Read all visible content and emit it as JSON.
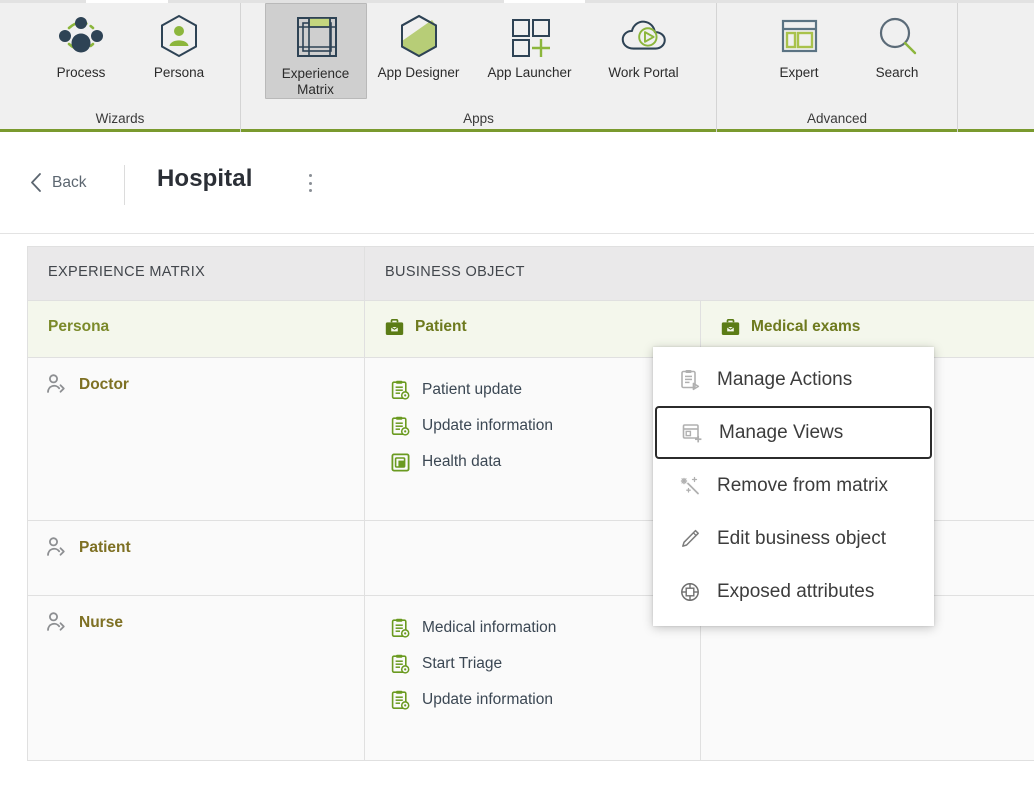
{
  "ribbon": {
    "groups": [
      {
        "label": "Wizards",
        "items": [
          {
            "label": "Process",
            "icon": "process-network-icon",
            "selected": false
          },
          {
            "label": "Persona",
            "icon": "persona-hexagon-user-icon",
            "selected": false
          }
        ]
      },
      {
        "label": "Apps",
        "items": [
          {
            "label": "Experience\nMatrix",
            "label_line1": "Experience",
            "label_line2": "Matrix",
            "icon": "experience-matrix-icon",
            "selected": true
          },
          {
            "label": "App Designer",
            "icon": "app-designer-hexagon-icon",
            "selected": false
          },
          {
            "label": "App Launcher",
            "icon": "app-launcher-grid-plus-icon",
            "selected": false
          },
          {
            "label": "Work Portal",
            "icon": "work-portal-cloud-play-icon",
            "selected": false
          }
        ]
      },
      {
        "label": "Advanced",
        "items": [
          {
            "label": "Expert",
            "icon": "expert-window-panels-icon",
            "selected": false
          },
          {
            "label": "Search",
            "icon": "search-magnifier-icon",
            "selected": false
          }
        ]
      }
    ]
  },
  "titlebar": {
    "back_label": "Back",
    "title": "Hospital",
    "more_icon": "kebab-menu-icon"
  },
  "matrix": {
    "band": {
      "col0": "EXPERIENCE MATRIX",
      "col1": "BUSINESS OBJECT",
      "col2": ""
    },
    "headers": {
      "persona": "Persona",
      "objects": [
        {
          "label": "Patient",
          "icon": "briefcase-icon"
        },
        {
          "label": "Medical exams",
          "icon": "briefcase-icon"
        }
      ]
    },
    "rows": [
      {
        "persona": "Doctor",
        "persona_icon": "persona-arrow-icon",
        "cells": [
          [
            {
              "label": "Patient update",
              "icon": "clipboard-gear-icon"
            },
            {
              "label": "Update information",
              "icon": "clipboard-gear-icon"
            },
            {
              "label": "Health data",
              "icon": "view-window-icon"
            }
          ],
          []
        ]
      },
      {
        "persona": "Patient",
        "persona_icon": "persona-arrow-icon",
        "cells": [
          [],
          []
        ]
      },
      {
        "persona": "Nurse",
        "persona_icon": "persona-arrow-icon",
        "cells": [
          [
            {
              "label": "Medical information",
              "icon": "clipboard-gear-icon"
            },
            {
              "label": "Start Triage",
              "icon": "clipboard-gear-icon"
            },
            {
              "label": "Update information",
              "icon": "clipboard-gear-icon"
            }
          ],
          []
        ]
      }
    ]
  },
  "context_menu": {
    "items": [
      {
        "label": "Manage Actions",
        "icon": "manage-actions-icon",
        "focused": false
      },
      {
        "label": "Manage Views",
        "icon": "manage-views-icon",
        "focused": true
      },
      {
        "label": "Remove from matrix",
        "icon": "remove-from-matrix-icon",
        "focused": false
      },
      {
        "label": "Edit business object",
        "icon": "pencil-edit-icon",
        "focused": false
      },
      {
        "label": "Exposed attributes",
        "icon": "exposed-attributes-icon",
        "focused": false
      }
    ]
  },
  "colors": {
    "accent_green": "#8cb63c",
    "dark_navy": "#2e4355",
    "ribbon_bg": "#f0f0f0",
    "ribbon_underline": "#7a9a2e",
    "header_band": "#eae9ea",
    "object_header_bg": "#f4f7ec",
    "object_header_text": "#6e7a1e",
    "persona_text": "#7e7023",
    "cell_bg": "#fafafa",
    "selected_tool_bg": "#cfcfcf",
    "focus_ring": "#2b2b2b"
  }
}
